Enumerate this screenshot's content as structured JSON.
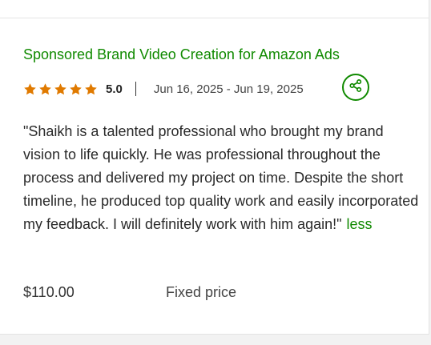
{
  "review": {
    "title": "Sponsored Brand Video Creation for Amazon Ads",
    "rating": "5.0",
    "stars": 5,
    "date_range": "Jun 16, 2025 - Jun 19, 2025",
    "feedback": "\"Shaikh is a talented professional who brought my brand vision to life quickly. He was professional throughout the process and delivered my project on time. Despite the short timeline, he produced top quality work and easily incorporated my feedback. I will definitely work with him again!\"",
    "less_label": "less",
    "price": "$110.00",
    "price_type": "Fixed price",
    "share_icon": "share-icon"
  },
  "colors": {
    "accent": "#108a00",
    "star": "#e07a00",
    "text": "#2a2a2a"
  }
}
